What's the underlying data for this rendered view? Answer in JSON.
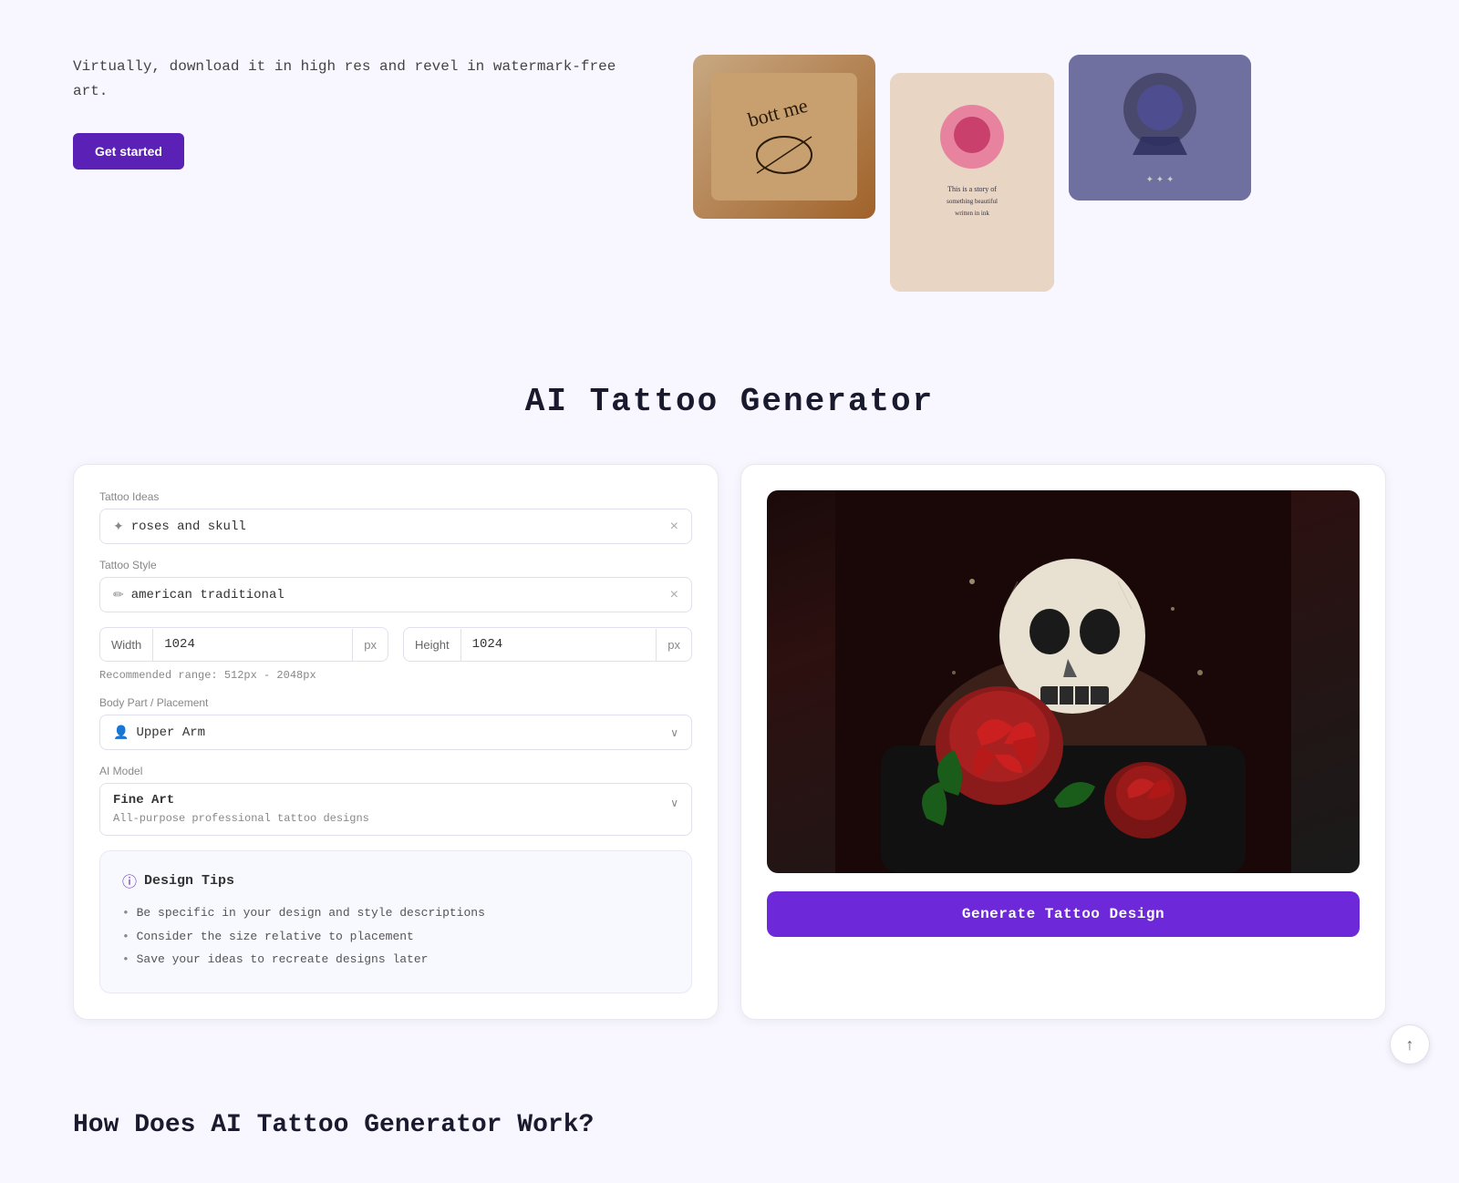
{
  "hero": {
    "description": "Virtually, download it in high res and revel in watermark-free art.",
    "cta_label": "Get started"
  },
  "section": {
    "title": "AI Tattoo Generator"
  },
  "form": {
    "tattoo_ideas_label": "Tattoo Ideas",
    "tattoo_ideas_placeholder": "roses and skull",
    "tattoo_ideas_value": "roses and skull",
    "tattoo_style_label": "Tattoo Style",
    "tattoo_style_value": "american traditional",
    "width_label": "Width",
    "width_value": "1024",
    "height_label": "Height",
    "height_value": "1024",
    "px_label": "px",
    "recommended_range": "Recommended range: 512px - 2048px",
    "body_part_label": "Body Part / Placement",
    "body_part_value": "Upper Arm",
    "ai_model_label": "AI Model",
    "ai_model_name": "Fine Art",
    "ai_model_desc": "All-purpose professional tattoo designs",
    "tips_title": "Design Tips",
    "tips": [
      "Be specific in your design and style descriptions",
      "Consider the size relative to placement",
      "Save your ideas to recreate designs later"
    ],
    "generate_btn": "Generate Tattoo Design"
  },
  "how_section": {
    "title": "How Does AI Tattoo Generator Work?"
  },
  "scroll_top_icon": "↑",
  "icons": {
    "ideas_icon": "✦",
    "style_icon": "✏",
    "person_icon": "👤",
    "info_icon": "ⓘ",
    "chevron_down": "∨",
    "clear": "×"
  }
}
